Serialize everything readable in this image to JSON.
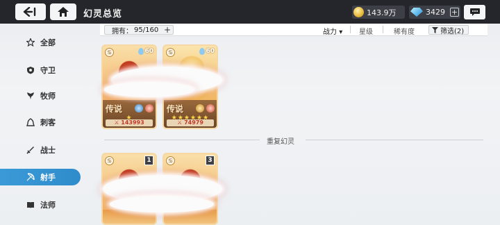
{
  "header": {
    "title": "幻灵总览",
    "gold": "143.9万",
    "gems": "3429"
  },
  "filter": {
    "owned_label": "拥有：",
    "owned_value": "95/160",
    "sort_power": "战力",
    "sort_star": "星级",
    "sort_rarity": "稀有度",
    "screen": "筛选(2)"
  },
  "sidebar": {
    "items": [
      {
        "label": "全部",
        "icon": "all-icon"
      },
      {
        "label": "守卫",
        "icon": "guard-icon"
      },
      {
        "label": "牧师",
        "icon": "priest-icon"
      },
      {
        "label": "刺客",
        "icon": "assassin-icon"
      },
      {
        "label": "战士",
        "icon": "warrior-icon"
      },
      {
        "label": "射手",
        "icon": "archer-icon",
        "active": true
      },
      {
        "label": "法师",
        "icon": "mage-icon"
      }
    ]
  },
  "cards": [
    {
      "rarity": "传说",
      "level": "60",
      "power": "143993",
      "stars": "★"
    },
    {
      "rarity": "传说",
      "level": "60",
      "power": "74979",
      "stars": "★★★★★★"
    }
  ],
  "duplicates": {
    "title": "重复幻灵",
    "cards": [
      {
        "badge": "1"
      },
      {
        "badge": "3"
      }
    ]
  },
  "colors": {
    "topbar": "#24262b",
    "active_tab": "#3a9ad6",
    "power_text": "#c0392b"
  }
}
